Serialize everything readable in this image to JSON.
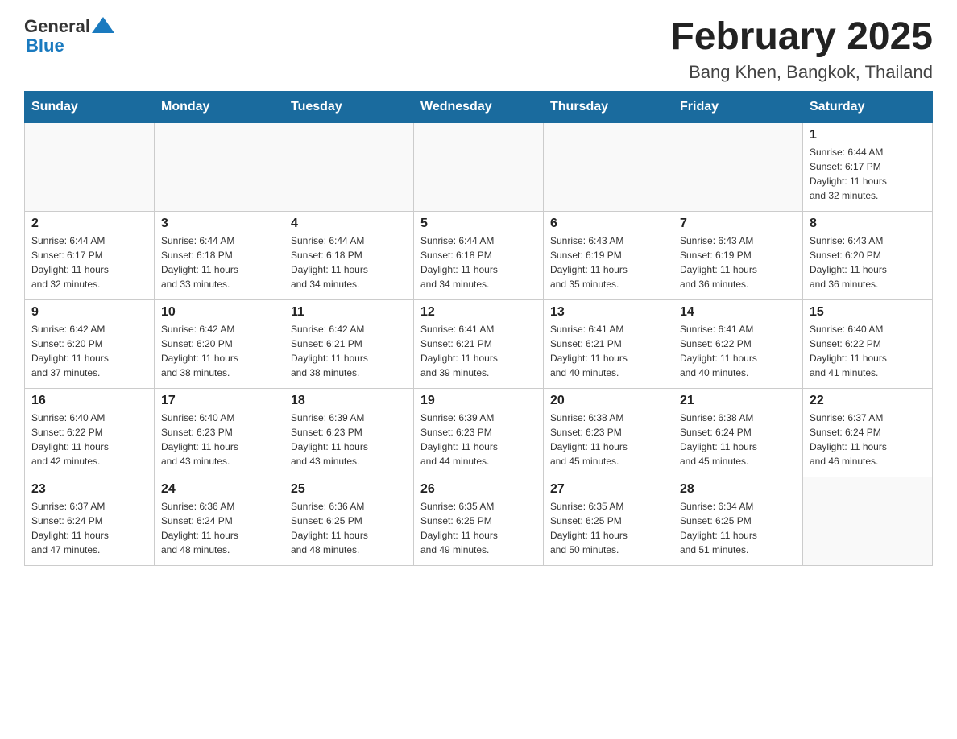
{
  "header": {
    "title": "February 2025",
    "subtitle": "Bang Khen, Bangkok, Thailand"
  },
  "logo": {
    "general": "General",
    "blue": "Blue"
  },
  "days_of_week": [
    "Sunday",
    "Monday",
    "Tuesday",
    "Wednesday",
    "Thursday",
    "Friday",
    "Saturday"
  ],
  "weeks": [
    [
      {
        "day": "",
        "info": ""
      },
      {
        "day": "",
        "info": ""
      },
      {
        "day": "",
        "info": ""
      },
      {
        "day": "",
        "info": ""
      },
      {
        "day": "",
        "info": ""
      },
      {
        "day": "",
        "info": ""
      },
      {
        "day": "1",
        "info": "Sunrise: 6:44 AM\nSunset: 6:17 PM\nDaylight: 11 hours\nand 32 minutes."
      }
    ],
    [
      {
        "day": "2",
        "info": "Sunrise: 6:44 AM\nSunset: 6:17 PM\nDaylight: 11 hours\nand 32 minutes."
      },
      {
        "day": "3",
        "info": "Sunrise: 6:44 AM\nSunset: 6:18 PM\nDaylight: 11 hours\nand 33 minutes."
      },
      {
        "day": "4",
        "info": "Sunrise: 6:44 AM\nSunset: 6:18 PM\nDaylight: 11 hours\nand 34 minutes."
      },
      {
        "day": "5",
        "info": "Sunrise: 6:44 AM\nSunset: 6:18 PM\nDaylight: 11 hours\nand 34 minutes."
      },
      {
        "day": "6",
        "info": "Sunrise: 6:43 AM\nSunset: 6:19 PM\nDaylight: 11 hours\nand 35 minutes."
      },
      {
        "day": "7",
        "info": "Sunrise: 6:43 AM\nSunset: 6:19 PM\nDaylight: 11 hours\nand 36 minutes."
      },
      {
        "day": "8",
        "info": "Sunrise: 6:43 AM\nSunset: 6:20 PM\nDaylight: 11 hours\nand 36 minutes."
      }
    ],
    [
      {
        "day": "9",
        "info": "Sunrise: 6:42 AM\nSunset: 6:20 PM\nDaylight: 11 hours\nand 37 minutes."
      },
      {
        "day": "10",
        "info": "Sunrise: 6:42 AM\nSunset: 6:20 PM\nDaylight: 11 hours\nand 38 minutes."
      },
      {
        "day": "11",
        "info": "Sunrise: 6:42 AM\nSunset: 6:21 PM\nDaylight: 11 hours\nand 38 minutes."
      },
      {
        "day": "12",
        "info": "Sunrise: 6:41 AM\nSunset: 6:21 PM\nDaylight: 11 hours\nand 39 minutes."
      },
      {
        "day": "13",
        "info": "Sunrise: 6:41 AM\nSunset: 6:21 PM\nDaylight: 11 hours\nand 40 minutes."
      },
      {
        "day": "14",
        "info": "Sunrise: 6:41 AM\nSunset: 6:22 PM\nDaylight: 11 hours\nand 40 minutes."
      },
      {
        "day": "15",
        "info": "Sunrise: 6:40 AM\nSunset: 6:22 PM\nDaylight: 11 hours\nand 41 minutes."
      }
    ],
    [
      {
        "day": "16",
        "info": "Sunrise: 6:40 AM\nSunset: 6:22 PM\nDaylight: 11 hours\nand 42 minutes."
      },
      {
        "day": "17",
        "info": "Sunrise: 6:40 AM\nSunset: 6:23 PM\nDaylight: 11 hours\nand 43 minutes."
      },
      {
        "day": "18",
        "info": "Sunrise: 6:39 AM\nSunset: 6:23 PM\nDaylight: 11 hours\nand 43 minutes."
      },
      {
        "day": "19",
        "info": "Sunrise: 6:39 AM\nSunset: 6:23 PM\nDaylight: 11 hours\nand 44 minutes."
      },
      {
        "day": "20",
        "info": "Sunrise: 6:38 AM\nSunset: 6:23 PM\nDaylight: 11 hours\nand 45 minutes."
      },
      {
        "day": "21",
        "info": "Sunrise: 6:38 AM\nSunset: 6:24 PM\nDaylight: 11 hours\nand 45 minutes."
      },
      {
        "day": "22",
        "info": "Sunrise: 6:37 AM\nSunset: 6:24 PM\nDaylight: 11 hours\nand 46 minutes."
      }
    ],
    [
      {
        "day": "23",
        "info": "Sunrise: 6:37 AM\nSunset: 6:24 PM\nDaylight: 11 hours\nand 47 minutes."
      },
      {
        "day": "24",
        "info": "Sunrise: 6:36 AM\nSunset: 6:24 PM\nDaylight: 11 hours\nand 48 minutes."
      },
      {
        "day": "25",
        "info": "Sunrise: 6:36 AM\nSunset: 6:25 PM\nDaylight: 11 hours\nand 48 minutes."
      },
      {
        "day": "26",
        "info": "Sunrise: 6:35 AM\nSunset: 6:25 PM\nDaylight: 11 hours\nand 49 minutes."
      },
      {
        "day": "27",
        "info": "Sunrise: 6:35 AM\nSunset: 6:25 PM\nDaylight: 11 hours\nand 50 minutes."
      },
      {
        "day": "28",
        "info": "Sunrise: 6:34 AM\nSunset: 6:25 PM\nDaylight: 11 hours\nand 51 minutes."
      },
      {
        "day": "",
        "info": ""
      }
    ]
  ]
}
